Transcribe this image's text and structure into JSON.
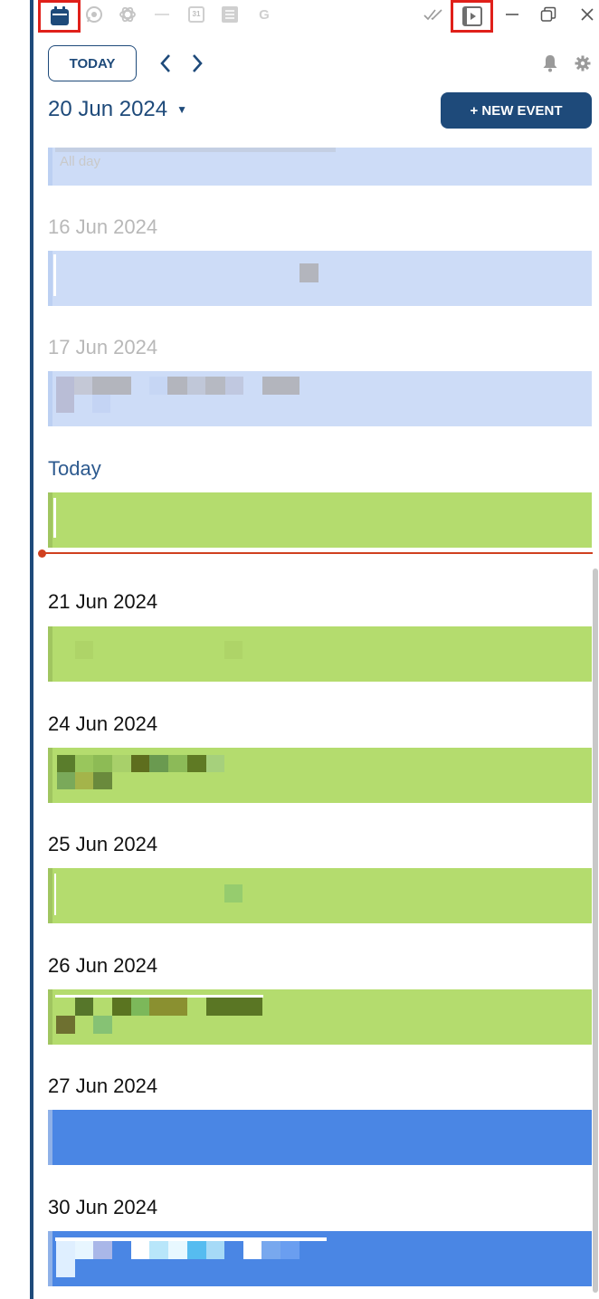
{
  "colors": {
    "brand": "#1e4a7a",
    "highlight_box": "#e0201a",
    "past_event_bg": "#cddcf7",
    "green_event_bg": "#b4dc6e",
    "blue_event_bg": "#4a86e4",
    "now_line": "#d0401f"
  },
  "topbar": {
    "apps": [
      "calendar-icon",
      "whatsapp-icon",
      "chatgpt-icon",
      "separator",
      "google-calendar-icon",
      "stack-icon",
      "google-icon"
    ],
    "google_calendar_badge": "31",
    "google_letter": "G",
    "right_icons": [
      "double-check-icon",
      "play-panel-icon",
      "minimize-icon",
      "restore-icon",
      "close-icon"
    ]
  },
  "toolbar": {
    "today_label": "TODAY",
    "prev_label": "‹",
    "next_label": "›",
    "new_event_label": "+ NEW EVENT"
  },
  "current_date": {
    "label": "20 Jun 2024",
    "caret": "▼"
  },
  "agenda": {
    "partial_event": {
      "subtitle": "All day"
    },
    "days": [
      {
        "label": "16 Jun 2024",
        "color": "past"
      },
      {
        "label": "17 Jun 2024",
        "color": "past"
      },
      {
        "label": "Today",
        "color": "today"
      },
      {
        "label": "21 Jun 2024",
        "color": "green"
      },
      {
        "label": "24 Jun 2024",
        "color": "green"
      },
      {
        "label": "25 Jun 2024",
        "color": "green"
      },
      {
        "label": "26 Jun 2024",
        "color": "green"
      },
      {
        "label": "27 Jun 2024",
        "color": "blue"
      },
      {
        "label": "30 Jun 2024",
        "color": "blue"
      }
    ]
  }
}
